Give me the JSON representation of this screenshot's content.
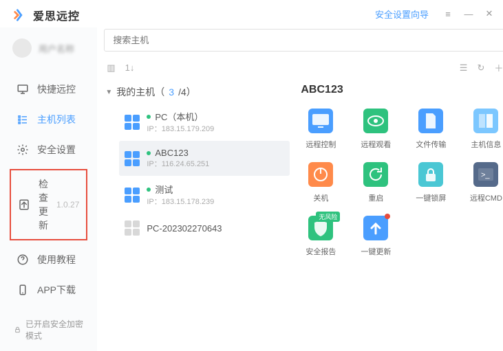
{
  "header": {
    "guide": "安全设置向导",
    "menu": "≡",
    "min": "—",
    "close": "✕"
  },
  "logo": {
    "text": "爱思远控"
  },
  "user": {
    "name": "用户名称"
  },
  "nav": {
    "quick": "快捷远控",
    "hosts": "主机列表",
    "security": "安全设置",
    "update": "检查更新",
    "version": "1.0.27",
    "tutorial": "使用教程",
    "download": "APP下载"
  },
  "footer": {
    "text": "已开启安全加密模式"
  },
  "search": {
    "placeholder": "搜索主机"
  },
  "tree": {
    "label_prefix": "我的主机（",
    "count_sel": "3",
    "count_total": "/4）",
    "hosts": [
      {
        "name": "PC（本机）",
        "ip": "IP：183.15.179.209",
        "online": true,
        "selected": false
      },
      {
        "name": "ABC123",
        "ip": "IP：116.24.65.251",
        "online": true,
        "selected": true
      },
      {
        "name": "测试",
        "ip": "IP：183.15.178.239",
        "online": true,
        "selected": false
      },
      {
        "name": "PC-202302270643",
        "ip": "",
        "online": false,
        "selected": false
      }
    ]
  },
  "detail": {
    "title": "ABC123",
    "actions": [
      {
        "label": "远程控制",
        "color": "#4a9eff",
        "icon": "screen"
      },
      {
        "label": "远程观看",
        "color": "#2ec27e",
        "icon": "eye"
      },
      {
        "label": "文件传输",
        "color": "#4a9eff",
        "icon": "file"
      },
      {
        "label": "主机信息",
        "color": "#7cc7ff",
        "icon": "info"
      },
      {
        "label": "关机",
        "color": "#ff8a4a",
        "icon": "power"
      },
      {
        "label": "重启",
        "color": "#2ec27e",
        "icon": "refresh"
      },
      {
        "label": "一键锁屏",
        "color": "#4ac7d4",
        "icon": "lock"
      },
      {
        "label": "远程CMD",
        "color": "#556a8a",
        "icon": "cmd"
      },
      {
        "label": "安全报告",
        "color": "#2ec27e",
        "icon": "shield",
        "badge": "无风险"
      },
      {
        "label": "一键更新",
        "color": "#4a9eff",
        "icon": "up",
        "dot": true
      }
    ]
  }
}
